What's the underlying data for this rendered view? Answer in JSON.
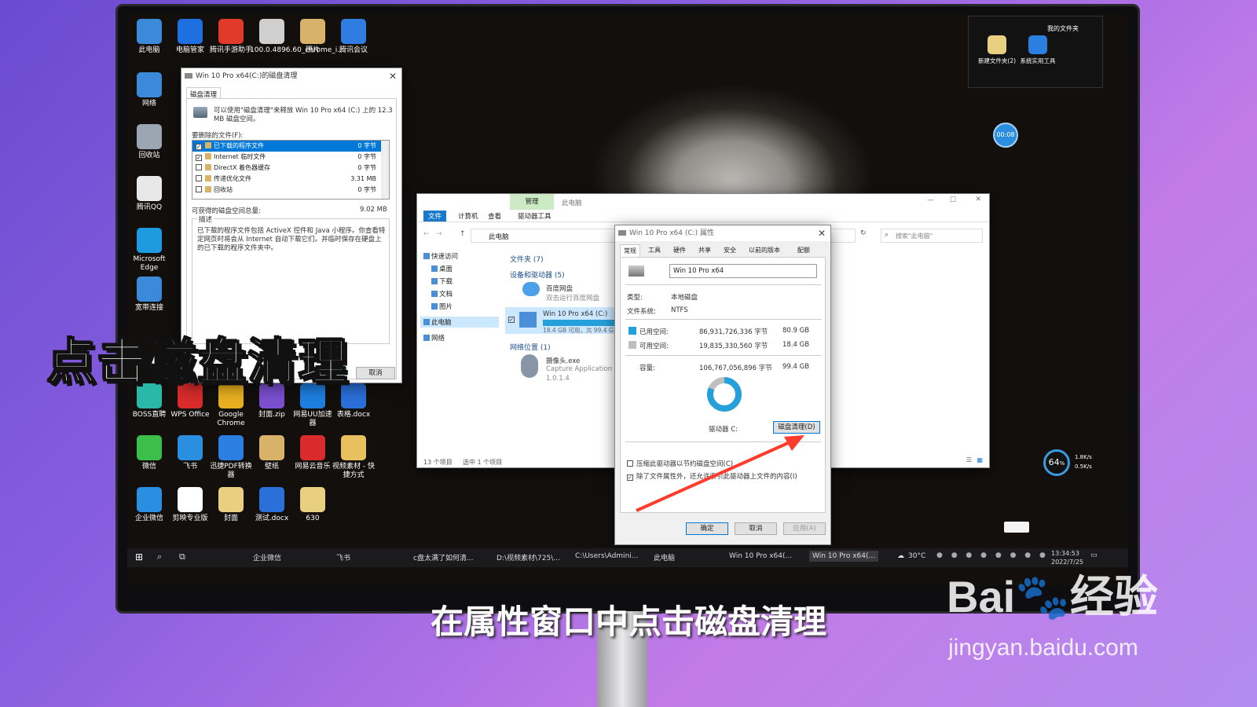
{
  "desktop_icons_left": [
    {
      "label": "此电脑",
      "color": "#3b8ad9"
    },
    {
      "label": "电脑管家",
      "color": "#1e6fe0"
    },
    {
      "label": "腾讯手游助手",
      "color": "#e03a2a"
    },
    {
      "label": "100.0.4896.60_chrome_i...",
      "color": "#cfcfcf"
    },
    {
      "label": "照片",
      "color": "#d9b26a"
    },
    {
      "label": "腾讯会议",
      "color": "#2f7de0"
    }
  ],
  "desktop_icons_col": [
    {
      "label": "网络",
      "color": "#3b8ad9"
    },
    {
      "label": "回收站",
      "color": "#9aa6b2"
    },
    {
      "label": "腾讯QQ",
      "color": "#e8e8e8"
    },
    {
      "label": "Microsoft Edge",
      "color": "#1e9be0"
    },
    {
      "label": "宽带连接",
      "color": "#3b8ad9"
    }
  ],
  "desktop_icons_row2": [
    {
      "label": "BOSS直聘",
      "color": "#2ab8a8"
    },
    {
      "label": "WPS Office",
      "color": "#d92b2b"
    },
    {
      "label": "Google Chrome",
      "color": "#e8b020"
    },
    {
      "label": "封面.zip",
      "color": "#7a4fd0"
    },
    {
      "label": "网易UU加速器",
      "color": "#1e7fe0"
    },
    {
      "label": "表格.docx",
      "color": "#2b6fd9"
    }
  ],
  "desktop_icons_row3": [
    {
      "label": "微信",
      "color": "#3bbf4a"
    },
    {
      "label": "飞书",
      "color": "#2a8fe0"
    },
    {
      "label": "迅捷PDF转换器",
      "color": "#2a7fe0"
    },
    {
      "label": "壁纸",
      "color": "#d9b26a"
    },
    {
      "label": "网易云音乐",
      "color": "#d92b2b"
    },
    {
      "label": "视频素材 - 快捷方式",
      "color": "#e8c060"
    }
  ],
  "desktop_icons_row4": [
    {
      "label": "企业微信",
      "color": "#2a8fe0"
    },
    {
      "label": "剪映专业版",
      "color": "#ffffff"
    },
    {
      "label": "封面",
      "color": "#e8d080"
    },
    {
      "label": "测试.docx",
      "color": "#2b6fd9"
    },
    {
      "label": "630",
      "color": "#e8d080"
    }
  ],
  "my_files": {
    "title": "我的文件夹",
    "items": [
      {
        "label": "新建文件夹(2)",
        "color": "#e8d080"
      },
      {
        "label": "系统实用工具",
        "color": "#2a7fe0"
      }
    ]
  },
  "timer": "00:08",
  "net_widget": {
    "percent": "64",
    "unit": "%",
    "up": "1.8K/s",
    "down": "0.5K/s"
  },
  "cleanup": {
    "title": "Win 10 Pro x64(C:)的磁盘清理",
    "tab": "磁盘清理",
    "intro": "可以使用\"磁盘清理\"来释放 Win 10 Pro x64 (C:) 上的 12.3 MB 磁盘空间。",
    "files_label": "要删除的文件(F):",
    "files": [
      {
        "name": "已下载的程序文件",
        "size": "0 字节",
        "checked": true,
        "selected": true
      },
      {
        "name": "Internet 临时文件",
        "size": "0 字节",
        "checked": true,
        "selected": false
      },
      {
        "name": "DirectX 着色器缓存",
        "size": "0 字节",
        "checked": false,
        "selected": false
      },
      {
        "name": "传递优化文件",
        "size": "3.31 MB",
        "checked": false,
        "selected": false
      },
      {
        "name": "回收站",
        "size": "0 字节",
        "checked": false,
        "selected": false
      }
    ],
    "total_label": "可获得的磁盘空间总量:",
    "total_value": "9.02 MB",
    "desc_label": "描述",
    "desc": "已下载的程序文件包括 ActiveX 控件和 Java 小程序。你查看特定网页时将会从 Internet 自动下载它们。并临时保存在硬盘上的已下载的程序文件夹中。",
    "ok": "确定",
    "cancel": "取消"
  },
  "explorer": {
    "title": "此电脑",
    "ribbon_manage": "管理",
    "tabs": [
      "文件",
      "计算机",
      "查看",
      "驱动器工具"
    ],
    "address": "此电脑",
    "search_placeholder": "搜索\"此电脑\"",
    "nav": [
      "快速访问",
      "桌面",
      "下载",
      "文档",
      "图片",
      "此电脑",
      "网络"
    ],
    "folders_header": "文件夹 (7)",
    "devices_header": "设备和驱动器 (5)",
    "baidu_name": "百度网盘",
    "baidu_sub": "双击运行百度网盘",
    "drive_name": "Win 10 Pro x64 (C:)",
    "drive_sub": "18.4 GB 可用，共 99.4 G",
    "netloc_header": "网络位置 (1)",
    "cam_name": "摄像头.exe",
    "cam_sub": "Capture Application",
    "cam_ver": "1.0.1.4",
    "status_left": "13 个项目",
    "status_sel": "选中 1 个项目"
  },
  "props": {
    "title": "Win 10 Pro x64 (C:) 属性",
    "tabs": [
      "常规",
      "工具",
      "硬件",
      "共享",
      "安全",
      "以前的版本",
      "配额"
    ],
    "name": "Win 10 Pro x64",
    "type_label": "类型:",
    "type": "本地磁盘",
    "fs_label": "文件系统:",
    "fs": "NTFS",
    "used_label": "已用空间:",
    "used_bytes": "86,931,726,336 字节",
    "used_gb": "80.9 GB",
    "free_label": "可用空间:",
    "free_bytes": "19,835,330,560 字节",
    "free_gb": "18.4 GB",
    "cap_label": "容量:",
    "cap_bytes": "106,767,056,896 字节",
    "cap_gb": "99.4 GB",
    "drive_label": "驱动器 C:",
    "cleanup_btn": "磁盘清理(D)",
    "compress": "压缩此驱动器以节约磁盘空间(C)",
    "index": "除了文件属性外，还允许索引此驱动器上文件的内容(I)",
    "ok": "确定",
    "cancel": "取消",
    "apply": "应用(A)",
    "used_fraction": 0.814,
    "colors": {
      "used": "#26a0da",
      "free": "#bfbfbf"
    }
  },
  "taskbar": {
    "items": [
      "企业微信",
      "飞书",
      "c盘太满了如何清...",
      "D:\\视频素材\\725\\...",
      "C:\\Users\\Admini...",
      "此电脑",
      "Win 10 Pro x64(...",
      "Win 10 Pro x64(..."
    ],
    "weather": "30°C",
    "time": "13:34:53",
    "date": "2022/7/25"
  },
  "big_caption": "点击磁盘清理",
  "subtitle": "在属性窗口中点击磁盘清理",
  "watermark": {
    "brand": "Bai",
    "brand2": "经验",
    "url": "jingyan.baidu.com"
  }
}
